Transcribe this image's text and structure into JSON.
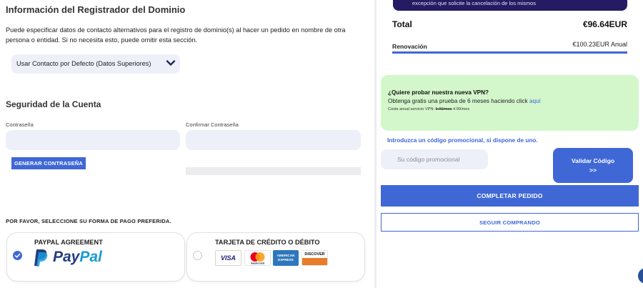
{
  "registrant": {
    "title": "Información del Registrador del Dominio",
    "description": "Puede especificar datos de contacto alternativos para el registro de dominio(s) al hacer un pedido en nombre de otra persona o entidad. Si no necesita esto, puede omitir esta sección.",
    "contact_select": "Usar Contacto por Defecto (Datos Superiores)"
  },
  "security": {
    "title": "Seguridad de la Cuenta",
    "password_label": "Contraseña",
    "confirm_label": "Confirmar Contraseña",
    "generate_button": "GENERAR CONTRASEÑA"
  },
  "payment": {
    "title": "POR FAVOR, SELECCIONE SU FORMA DE PAGO PREFERIDA.",
    "options": [
      {
        "label": "PAYPAL AGREEMENT",
        "selected": true,
        "logo_text_1": "Pay",
        "logo_text_2": "Pal"
      },
      {
        "label": "TARJETA DE CRÉDITO O DÉBITO",
        "selected": false
      }
    ],
    "cards": [
      {
        "name": "visa-logo",
        "text": "VISA",
        "color": "#1a1f71"
      },
      {
        "name": "mastercard-logo",
        "text": "mastercard",
        "color": "#ffffff"
      },
      {
        "name": "amex-logo",
        "text": "AMERICAN EXPRESS",
        "color": "#2e77bc"
      },
      {
        "name": "discover-logo",
        "text": "DISCOVER",
        "color": "#e87c2a"
      }
    ]
  },
  "summary": {
    "banner_text": "excepción que solicite la cancelación de los mismos",
    "total_label": "Total",
    "total_value": "€96.64EUR",
    "renewal_label": "Renovación",
    "renewal_value": "€100.23EUR Anual"
  },
  "vpn": {
    "question": "¿Quiere probar nuestra nueva VPN?",
    "line": "Obtenga gratis una prueba de 6 meses haciendo click",
    "link": "aquí",
    "small_prefix": "Coste anual servicio VPN:",
    "old_price": "9.99/mes",
    "new_price": "4.99/mes"
  },
  "promo": {
    "hint": "Introduzca un código promocional, si dispone de uno.",
    "placeholder": "Su código promocional",
    "validate_label": "Validar Código",
    "validate_arrow": ">>"
  },
  "actions": {
    "complete": "COMPLETAR PEDIDO",
    "continue": "SEGUIR COMPRANDO"
  },
  "colors": {
    "accent": "#3f68d6",
    "banner": "#241b63",
    "vpn_bg": "#d3f7cb"
  }
}
